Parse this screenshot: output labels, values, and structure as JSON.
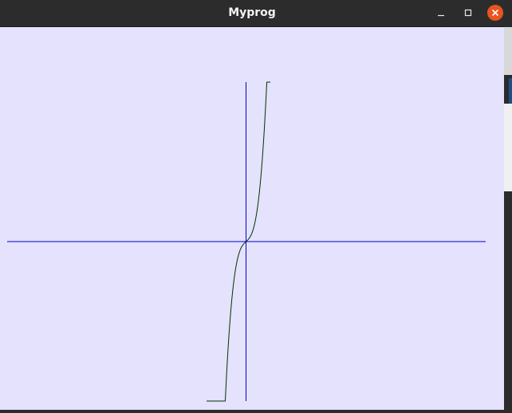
{
  "window": {
    "title": "Myprog",
    "controls": {
      "minimize_icon": "minimize-icon",
      "maximize_icon": "maximize-icon",
      "close_icon": "close-icon"
    }
  },
  "colors": {
    "titlebar": "#2c2c2c",
    "title_text": "#f2f2f2",
    "canvas_background": "#e4e2fd",
    "axes": "#0000cc",
    "curve": "#003300",
    "close_button": "#e95420"
  }
}
